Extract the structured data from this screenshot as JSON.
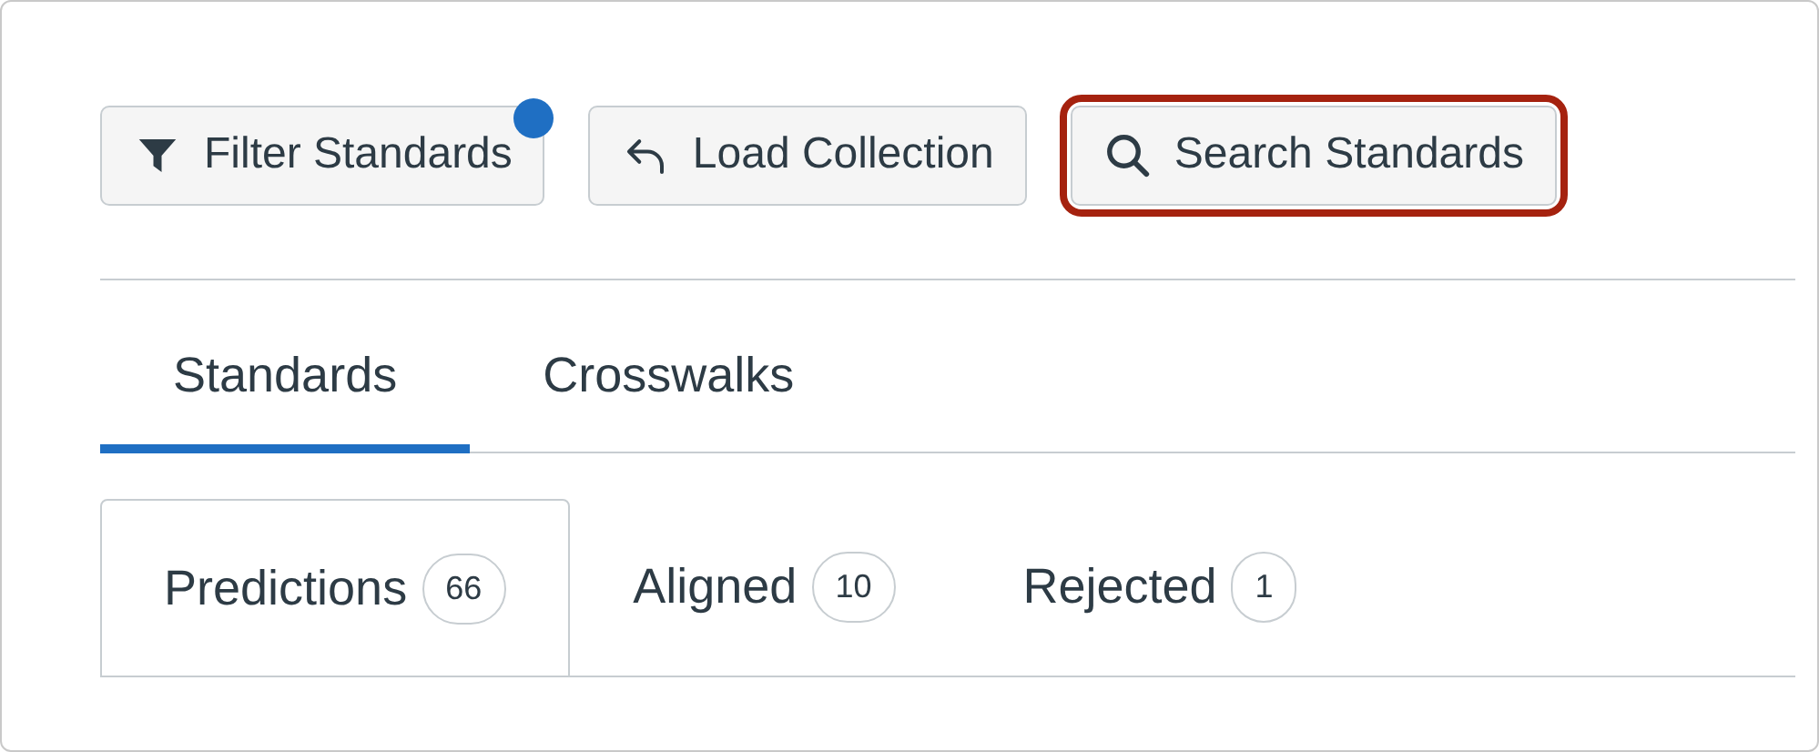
{
  "toolbar": [
    {
      "label": "Filter Standards",
      "kind": "filter",
      "indicator": true,
      "highlighted": false
    },
    {
      "label": "Load Collection",
      "kind": "undo",
      "indicator": false,
      "highlighted": false
    },
    {
      "label": "Search Standards",
      "kind": "search",
      "indicator": false,
      "highlighted": true
    }
  ],
  "tabs": [
    {
      "label": "Standards",
      "selected": true
    },
    {
      "label": "Crosswalks",
      "selected": false
    }
  ],
  "subtabs": [
    {
      "label": "Predictions",
      "count": "66",
      "selected": true
    },
    {
      "label": "Aligned",
      "count": "10",
      "selected": false
    },
    {
      "label": "Rejected",
      "count": "1",
      "selected": false
    }
  ]
}
